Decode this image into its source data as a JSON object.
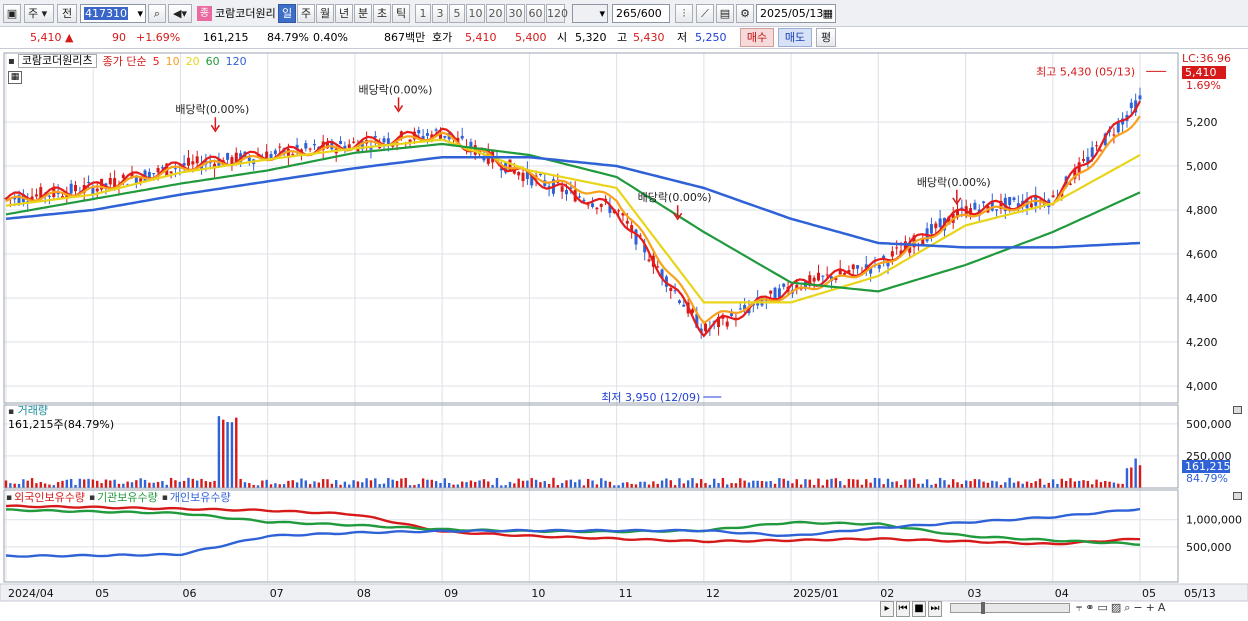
{
  "toolbar": {
    "market": "주",
    "type": "전",
    "code": "417310",
    "name": "코람코더원리",
    "name_badge": "종",
    "periods": [
      "일",
      "주",
      "월",
      "년",
      "분",
      "초",
      "틱"
    ],
    "period_selected": "일",
    "intervals": [
      "1",
      "3",
      "5",
      "10",
      "20",
      "30",
      "60",
      "120"
    ],
    "count": "265",
    "count_total": "/600",
    "date": "2025/05/13"
  },
  "quote": {
    "price": "5,410",
    "change": "90",
    "change_pct": "+1.69%",
    "volume": "161,215",
    "vol_ratio": "84.79%",
    "turnover": "0.40%",
    "amount": "867백만",
    "ask_label": "호가",
    "ask": "5,410",
    "bid": "5,400",
    "open_label": "시",
    "open": "5,320",
    "high_label": "고",
    "high": "5,430",
    "low_label": "저",
    "low": "5,250",
    "buy": "매수",
    "sell": "매도",
    "eval": "평"
  },
  "legend": {
    "stock": "코람코더원리츠",
    "ma_prefix": "종가 단순",
    "ma": [
      {
        "period": "5",
        "color": "#e51c1c"
      },
      {
        "period": "10",
        "color": "#f7a21b"
      },
      {
        "period": "20",
        "color": "#e8d51a"
      },
      {
        "period": "60",
        "color": "#209a3c"
      },
      {
        "period": "120",
        "color": "#2f62d6"
      }
    ]
  },
  "annotations": {
    "dividends": [
      "배당락(0.00%)",
      "배당락(0.00%)",
      "배당락(0.00%)",
      "배당락(0.00%)"
    ],
    "high_label": "최고 5,430 (05/13)",
    "low_label": "최저 3,950 (12/09)"
  },
  "axis_right": {
    "lc": "LC:36.96",
    "last_price": "5,410",
    "last_pct": "1.69%",
    "vol_last": "161,215",
    "vol_pct": "84.79%"
  },
  "volume_panel": {
    "title": "거래량",
    "info": "161,215주(84.79%)"
  },
  "holding_panel": {
    "titles": [
      "외국인보유수량",
      "기관보유수량",
      "개인보유수량"
    ],
    "colors": [
      "#d61a1a",
      "#209a3c",
      "#2f62d6"
    ]
  },
  "x_axis": [
    "2024/04",
    "05",
    "06",
    "07",
    "08",
    "09",
    "10",
    "11",
    "12",
    "2025/01",
    "02",
    "03",
    "04",
    "05",
    "05/13"
  ],
  "chart_data": [
    {
      "type": "line",
      "title": "코람코더원리츠",
      "x": [
        "2024/04",
        "05",
        "06",
        "07",
        "08",
        "09",
        "10",
        "11",
        "12",
        "2025/01",
        "02",
        "03",
        "04",
        "05"
      ],
      "ylim": [
        3950,
        5450
      ],
      "yticks": [
        4000,
        4200,
        4400,
        4600,
        4800,
        5000,
        5200
      ],
      "series": [
        {
          "name": "5",
          "values": [
            4850,
            4900,
            5000,
            5050,
            5100,
            5150,
            4950,
            4800,
            4250,
            4450,
            4550,
            4800,
            4850,
            5300
          ]
        },
        {
          "name": "10",
          "values": [
            4840,
            4890,
            4990,
            5040,
            5090,
            5140,
            4960,
            4850,
            4300,
            4420,
            4540,
            4780,
            4840,
            5230
          ]
        },
        {
          "name": "20",
          "values": [
            4820,
            4870,
            4970,
            5030,
            5080,
            5120,
            4980,
            4900,
            4380,
            4380,
            4500,
            4730,
            4830,
            5050
          ]
        },
        {
          "name": "60",
          "values": [
            4780,
            4850,
            4920,
            4980,
            5060,
            5100,
            5050,
            4950,
            4700,
            4470,
            4430,
            4550,
            4700,
            4880
          ]
        },
        {
          "name": "120",
          "values": [
            4760,
            4800,
            4870,
            4930,
            4990,
            5040,
            5040,
            5000,
            4900,
            4760,
            4650,
            4630,
            4630,
            4650
          ]
        }
      ],
      "annotations": {
        "high": {
          "value": 5430,
          "date": "05/13"
        },
        "low": {
          "value": 3950,
          "date": "12/09"
        }
      }
    },
    {
      "type": "bar",
      "title": "거래량",
      "ylim": [
        0,
        600000
      ],
      "yticks": [
        250000,
        500000
      ],
      "last": 161215
    },
    {
      "type": "line",
      "title": "외국인보유수량",
      "yticks": [
        500000,
        1000000
      ],
      "series": [
        {
          "name": "외국인보유수량",
          "values": [
            1250000,
            1230000,
            1200000,
            1170000,
            1100000,
            780000,
            700000,
            650000,
            600000,
            620000,
            650000,
            600000,
            550000,
            650000
          ]
        },
        {
          "name": "기관보유수량",
          "values": [
            1180000,
            1150000,
            1120000,
            960000,
            900000,
            820000,
            790000,
            780000,
            800000,
            950000,
            920000,
            700000,
            620000,
            550000
          ]
        },
        {
          "name": "개인보유수량",
          "values": [
            330000,
            340000,
            360000,
            700000,
            760000,
            790000,
            800000,
            800000,
            800000,
            700000,
            850000,
            950000,
            1050000,
            1200000
          ]
        }
      ]
    }
  ]
}
